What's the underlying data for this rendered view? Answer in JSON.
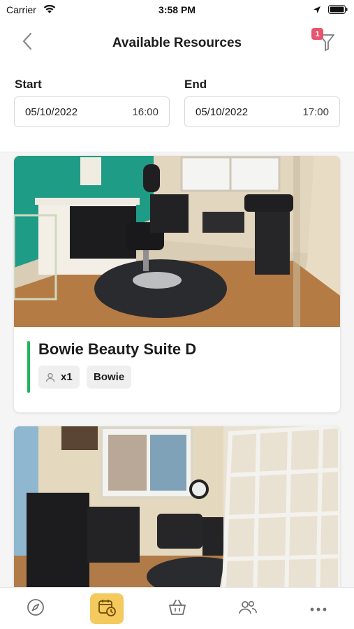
{
  "status_bar": {
    "carrier": "Carrier",
    "time": "3:58 PM"
  },
  "header": {
    "title": "Available Resources",
    "filter_badge_count": "1",
    "start_label": "Start",
    "end_label": "End",
    "start": {
      "date": "05/10/2022",
      "time": "16:00"
    },
    "end": {
      "date": "05/10/2022",
      "time": "17:00"
    }
  },
  "resources": [
    {
      "name": "Bowie Beauty Suite D",
      "capacity": "x1",
      "location": "Bowie",
      "accent_color": "#22b35e"
    },
    {
      "photo": "salon-room-photo"
    }
  ],
  "tab_bar": {
    "items": [
      {
        "icon": "compass-icon",
        "active": false
      },
      {
        "icon": "calendar-clock-icon",
        "active": true
      },
      {
        "icon": "basket-icon",
        "active": false
      },
      {
        "icon": "people-icon",
        "active": false
      },
      {
        "icon": "more-icon",
        "active": false
      }
    ],
    "accent": "#f4c95d"
  }
}
